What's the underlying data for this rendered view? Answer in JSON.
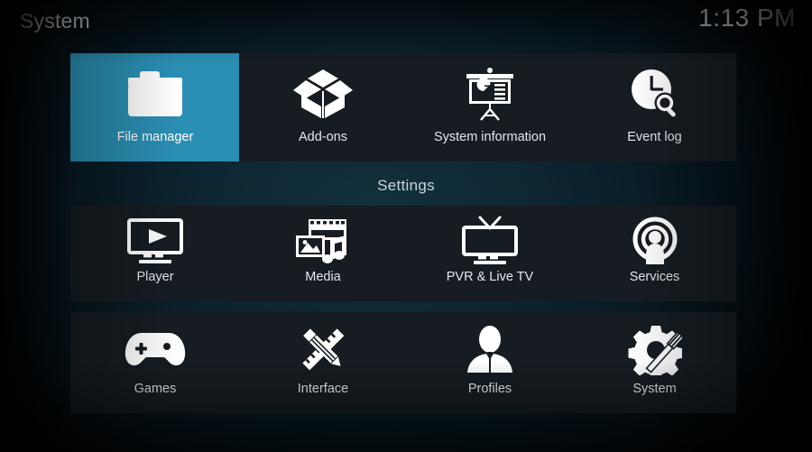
{
  "header": {
    "title": "System",
    "clock": "1:13 PM"
  },
  "section": {
    "settings_label": "Settings"
  },
  "colors": {
    "selected_tile": "#2b8fb4",
    "tile_background": "#161c22",
    "text": "#e2e9ee",
    "background_center": "#12303d"
  },
  "top_row": {
    "tiles": [
      {
        "label": "File manager",
        "icon": "folder-icon",
        "selected": true
      },
      {
        "label": "Add-ons",
        "icon": "open-box-icon",
        "selected": false
      },
      {
        "label": "System information",
        "icon": "presentation-icon",
        "selected": false
      },
      {
        "label": "Event log",
        "icon": "clock-search-icon",
        "selected": false
      }
    ]
  },
  "settings_rows": [
    {
      "tiles": [
        {
          "label": "Player",
          "icon": "monitor-play-icon",
          "selected": false
        },
        {
          "label": "Media",
          "icon": "media-library-icon",
          "selected": false
        },
        {
          "label": "PVR & Live TV",
          "icon": "tv-antenna-icon",
          "selected": false
        },
        {
          "label": "Services",
          "icon": "broadcast-person-icon",
          "selected": false
        }
      ]
    },
    {
      "tiles": [
        {
          "label": "Games",
          "icon": "gamepad-icon",
          "selected": false
        },
        {
          "label": "Interface",
          "icon": "pencil-ruler-icon",
          "selected": false
        },
        {
          "label": "Profiles",
          "icon": "person-bust-icon",
          "selected": false
        },
        {
          "label": "System",
          "icon": "gear-screwdriver-icon",
          "selected": false
        }
      ]
    }
  ]
}
